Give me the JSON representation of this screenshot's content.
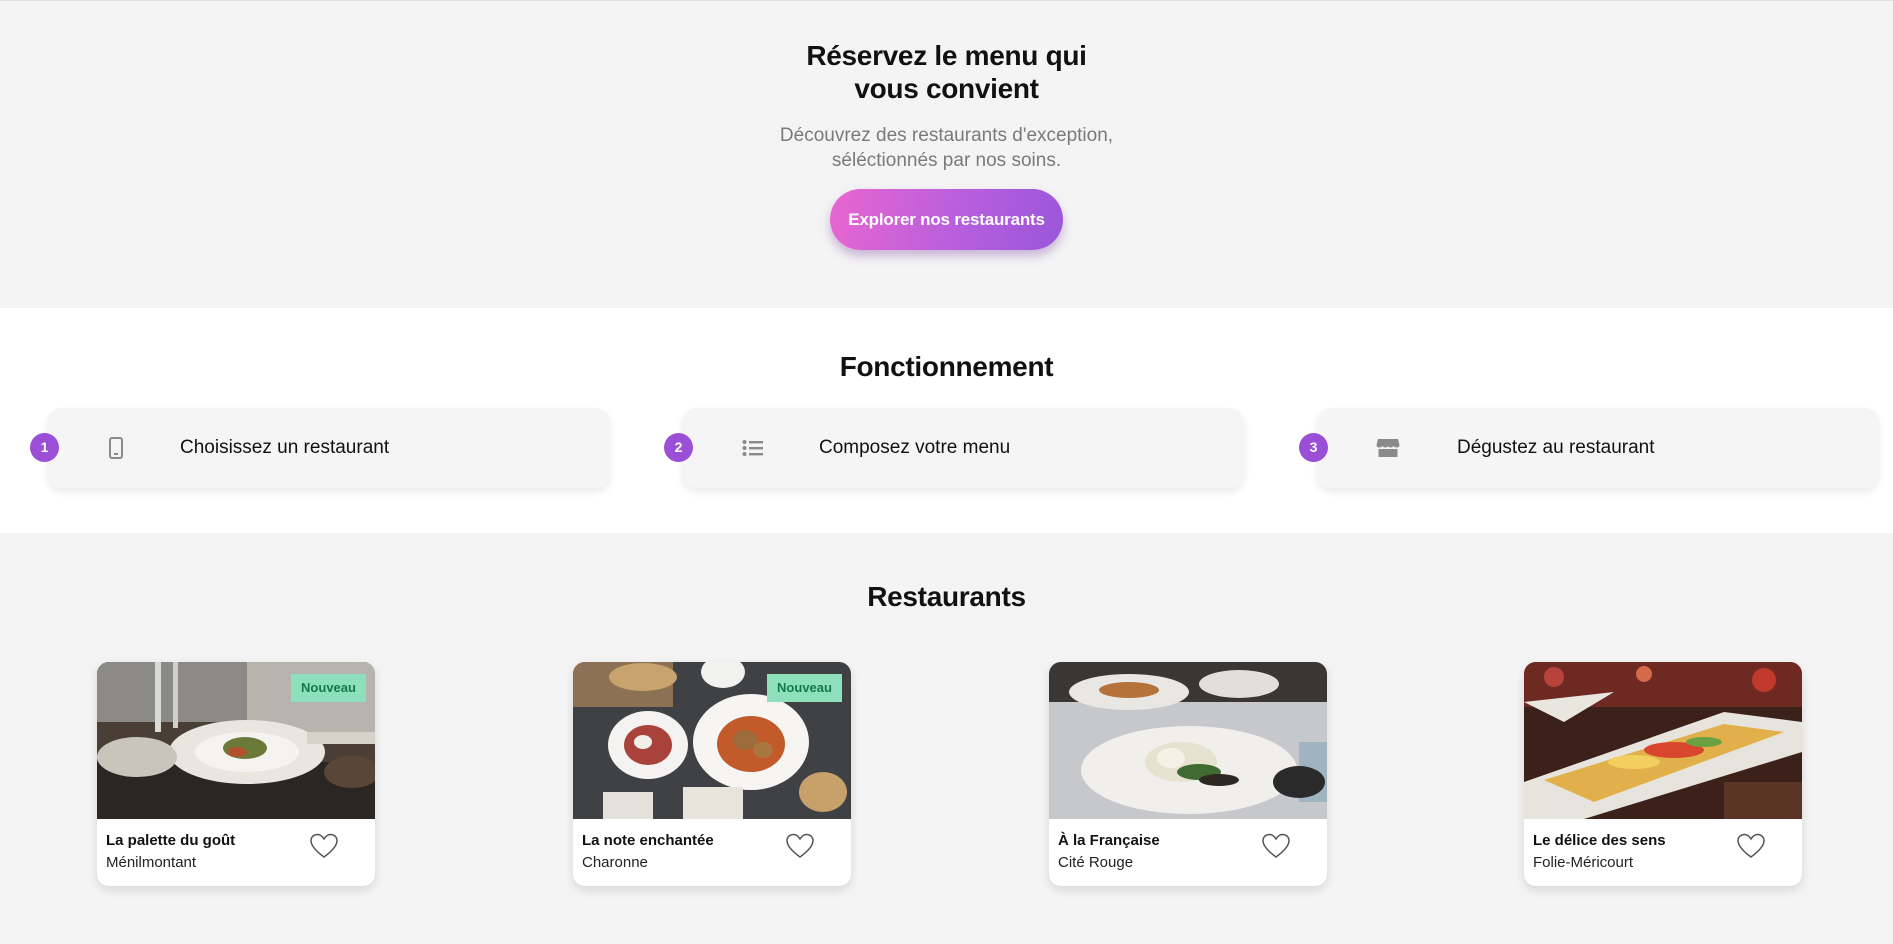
{
  "hero": {
    "title": "Réservez le menu qui vous convient",
    "subtitle": "Découvrez des restaurants d'exception, séléctionnés par nos soins.",
    "cta_label": "Explorer nos restaurants"
  },
  "how_it_works": {
    "title": "Fonctionnement",
    "steps": [
      {
        "number": "1",
        "icon": "smartphone-icon",
        "label": "Choisissez un restaurant"
      },
      {
        "number": "2",
        "icon": "list-icon",
        "label": "Composez votre menu"
      },
      {
        "number": "3",
        "icon": "store-icon",
        "label": "Dégustez au restaurant"
      }
    ]
  },
  "restaurants": {
    "title": "Restaurants",
    "items": [
      {
        "name": "La palette du goût",
        "area": "Ménilmontant",
        "badge": "Nouveau"
      },
      {
        "name": "La note enchantée",
        "area": "Charonne",
        "badge": "Nouveau"
      },
      {
        "name": "À la Française",
        "area": "Cité Rouge",
        "badge": ""
      },
      {
        "name": "Le délice des sens",
        "area": "Folie-Méricourt",
        "badge": ""
      }
    ]
  },
  "colors": {
    "accent_purple": "#9a4fd6",
    "cta_gradient_start": "#e866d0",
    "cta_gradient_end": "#9a56d8",
    "badge_bg": "#8ee0bd",
    "badge_text": "#137a4a"
  }
}
